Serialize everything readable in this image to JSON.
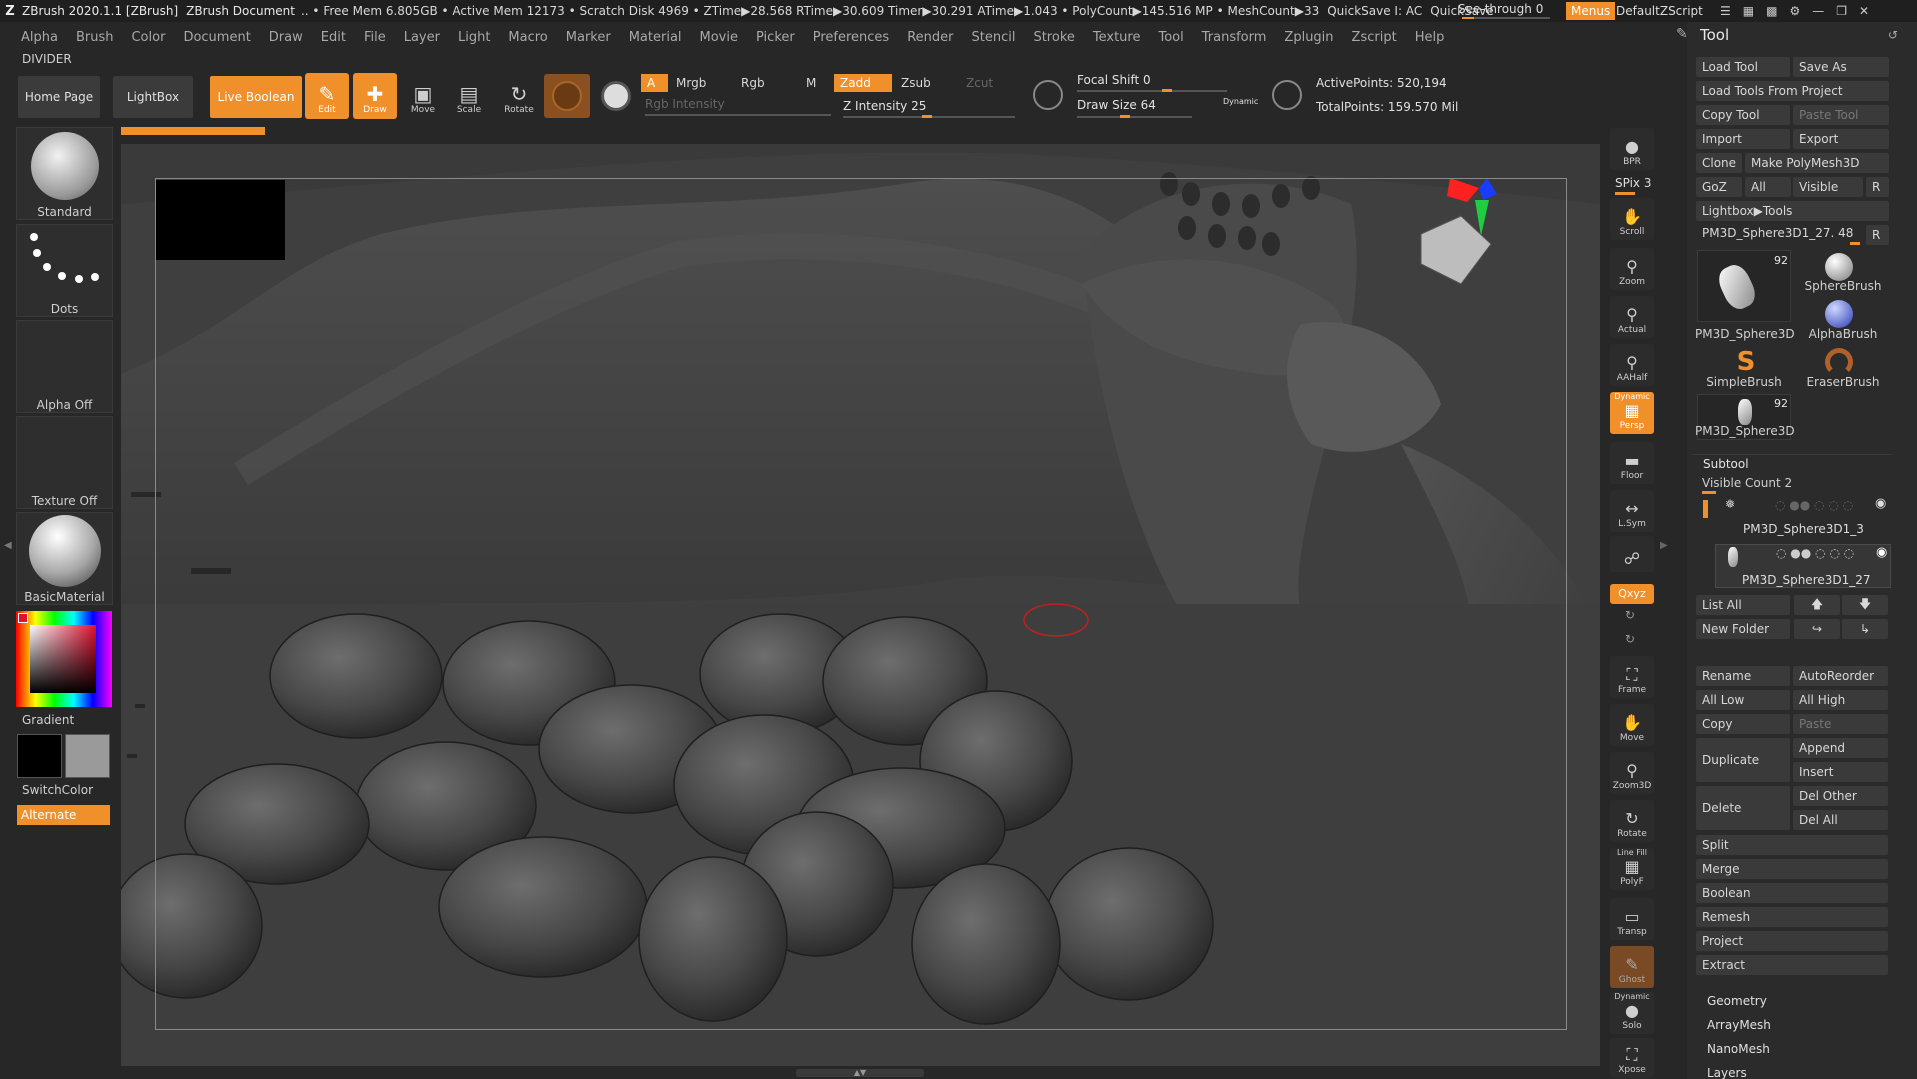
{
  "titlebar": {
    "app": "ZBrush 2020.1.1 [ZBrush]",
    "document": "ZBrush Document",
    "stats": ".. • Free Mem 6.805GB • Active Mem 12173 • Scratch Disk 4969 • ZTime▶28.568 RTime▶30.609 Timer▶30.291 ATime▶1.043 • PolyCount▶145.516 MP • MeshCount▶33",
    "quicksave_info": "QuickSave I: AC",
    "quicksave": "QuickSave",
    "see_through_label": "See-through",
    "see_through_value": "0",
    "menus": "Menus",
    "default_zscript": "DefaultZScript"
  },
  "menubar": [
    "Alpha",
    "Brush",
    "Color",
    "Document",
    "Draw",
    "Edit",
    "File",
    "Layer",
    "Light",
    "Macro",
    "Marker",
    "Material",
    "Movie",
    "Picker",
    "Preferences",
    "Render",
    "Stencil",
    "Stroke",
    "Texture",
    "Tool",
    "Transform",
    "Zplugin",
    "Zscript",
    "Help"
  ],
  "divider_label": "DIVIDER",
  "toolbar": {
    "home_page": "Home Page",
    "lightbox": "LightBox",
    "live_boolean": "Live Boolean",
    "edit": "Edit",
    "draw": "Draw",
    "move": "Move",
    "scale": "Scale",
    "rotate": "Rotate",
    "a": "A",
    "mrgb": "Mrgb",
    "rgb": "Rgb",
    "m": "M",
    "zadd": "Zadd",
    "zsub": "Zsub",
    "zcut": "Zcut",
    "rgb_intensity": "Rgb Intensity",
    "z_intensity_label": "Z Intensity",
    "z_intensity_value": "25",
    "focal_shift_label": "Focal Shift",
    "focal_shift_value": "0",
    "draw_size_label": "Draw Size",
    "draw_size_value": "64",
    "dynamic": "Dynamic",
    "active_points": "ActivePoints: 520,194",
    "total_points": "TotalPoints: 159.570 Mil"
  },
  "shelf": {
    "brush": "Standard",
    "stroke": "Dots",
    "alpha": "Alpha Off",
    "texture": "Texture Off",
    "material": "BasicMaterial",
    "gradient": "Gradient",
    "switch_color": "SwitchColor",
    "alternate": "Alternate"
  },
  "right_tools": {
    "bpr": "BPR",
    "spix": "SPix 3",
    "scroll": "Scroll",
    "zoom": "Zoom",
    "actual": "Actual",
    "aahalf": "AAHalf",
    "dynamic": "Dynamic",
    "persp": "Persp",
    "floor": "Floor",
    "lsym": "L.Sym",
    "xyz": "Qxyz",
    "frame": "Frame",
    "move": "Move",
    "zoom3d": "Zoom3D",
    "rotate": "Rotate",
    "line_fill": "Line Fill",
    "polyf": "PolyF",
    "transp": "Transp",
    "ghost": "Ghost",
    "solo": "Solo",
    "xpose": "Xpose"
  },
  "tool_panel": {
    "title": "Tool",
    "load_tool": "Load Tool",
    "save_as": "Save As",
    "load_from_project": "Load Tools From Project",
    "copy_tool": "Copy Tool",
    "paste_tool": "Paste Tool",
    "import": "Import",
    "export": "Export",
    "clone": "Clone",
    "make_polymesh": "Make PolyMesh3D",
    "goz": "GoZ",
    "all": "All",
    "visible": "Visible",
    "r": "R",
    "lightbox_tools": "Lightbox▶Tools",
    "current_tool": "PM3D_Sphere3D1_27. 48",
    "tools": [
      {
        "name": "PM3D_Sphere3D",
        "count": "92"
      },
      {
        "name": "SphereBrush",
        "count": ""
      },
      {
        "name": "AlphaBrush",
        "count": ""
      },
      {
        "name": "SimpleBrush",
        "count": ""
      },
      {
        "name": "EraserBrush",
        "count": ""
      },
      {
        "name": "PM3D_Sphere3D",
        "count": "92"
      }
    ],
    "subtool": "Subtool",
    "visible_count": "Visible Count 2",
    "subtools": [
      "PM3D_Sphere3D1_3",
      "PM3D_Sphere3D1_27"
    ],
    "list_all": "List All",
    "new_folder": "New Folder",
    "rename": "Rename",
    "auto_reorder": "AutoReorder",
    "all_low": "All Low",
    "all_high": "All High",
    "copy": "Copy",
    "paste": "Paste",
    "duplicate": "Duplicate",
    "append": "Append",
    "insert": "Insert",
    "delete": "Delete",
    "del_other": "Del Other",
    "del_all": "Del All",
    "split": "Split",
    "merge": "Merge",
    "boolean": "Boolean",
    "remesh": "Remesh",
    "project": "Project",
    "extract": "Extract",
    "geometry": "Geometry",
    "arraymesh": "ArrayMesh",
    "nanomesh": "NanoMesh",
    "layers": "Layers"
  },
  "colors": {
    "accent": "#f0902a",
    "bg": "#272727",
    "panel": "#2b2b2b"
  }
}
